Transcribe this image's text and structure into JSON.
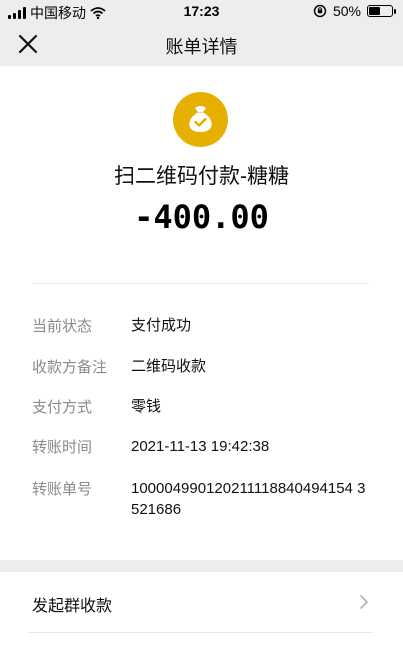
{
  "status_bar": {
    "carrier": "中国移动",
    "time": "17:23",
    "battery": "50%",
    "battery_level": 0.5
  },
  "header": {
    "title": "账单详情"
  },
  "bill": {
    "merchant": "扫二维码付款-糖糖",
    "amount": "-400.00",
    "accent_color": "#e6b000"
  },
  "details": [
    {
      "label": "当前状态",
      "value": "支付成功"
    },
    {
      "label": "收款方备注",
      "value": "二维码收款"
    },
    {
      "label": "支付方式",
      "value": "零钱"
    },
    {
      "label": "转账时间",
      "value": "2021-11-13 19:42:38"
    },
    {
      "label": "转账单号",
      "value": "100004990120211118840494154 3521686"
    }
  ],
  "actions": {
    "group_collect": "发起群收款"
  }
}
